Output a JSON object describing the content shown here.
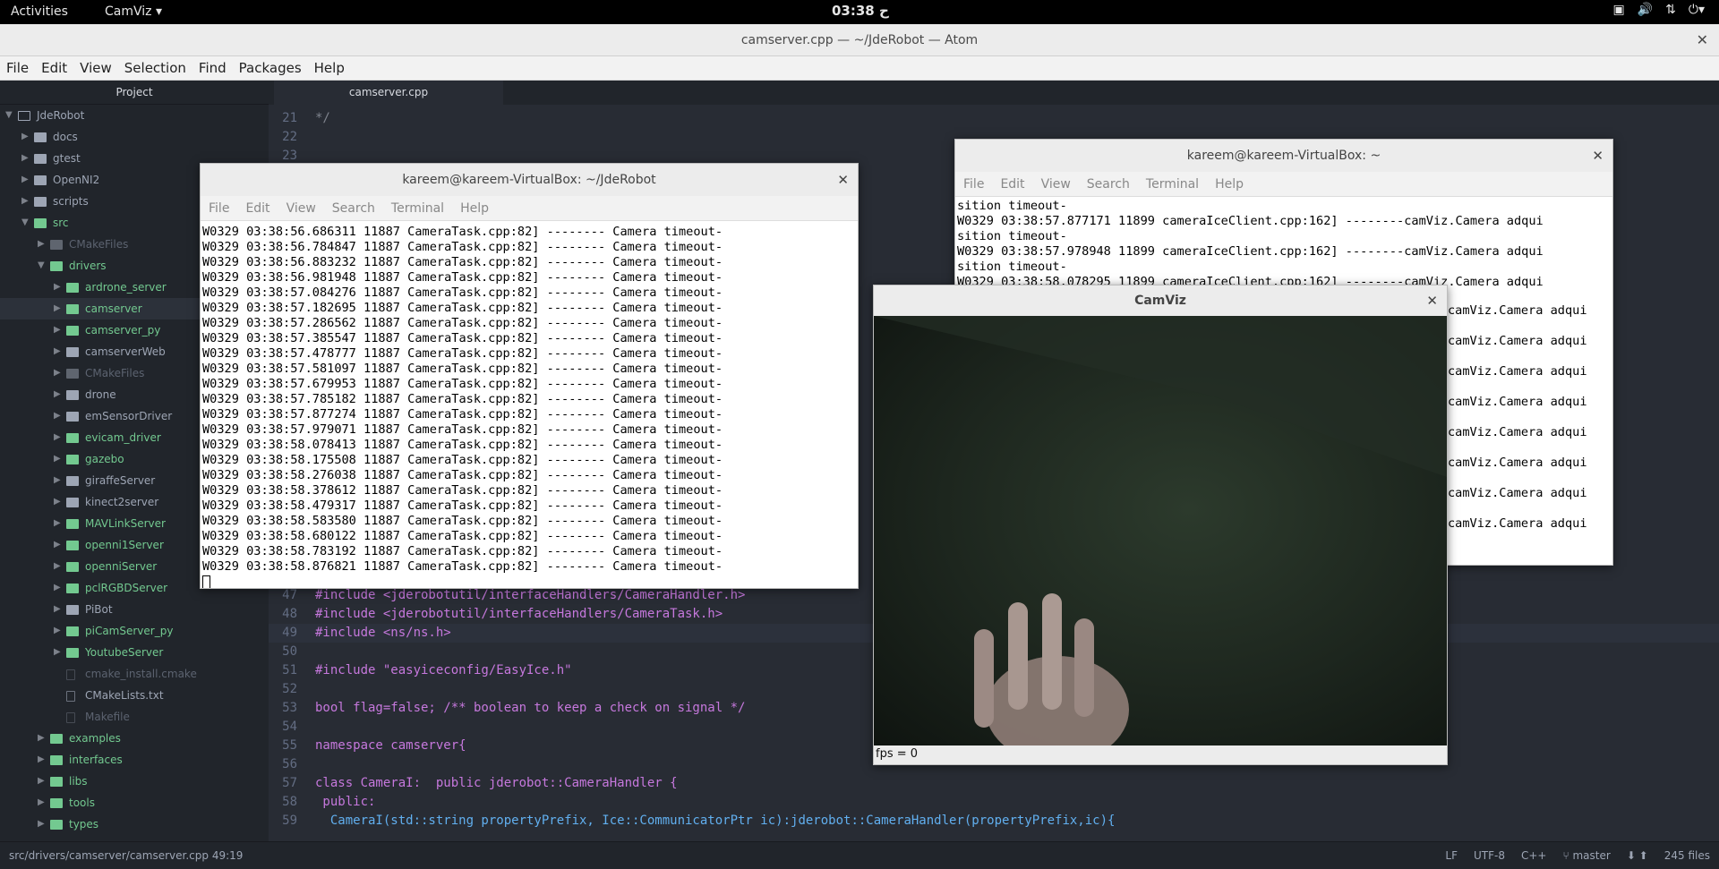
{
  "topbar": {
    "activities": "Activities",
    "app_menu": "CamViz ▾",
    "clock": "03:38 ح"
  },
  "atom": {
    "title": "camserver.cpp — ~/JdeRobot — Atom",
    "menu": [
      "File",
      "Edit",
      "View",
      "Selection",
      "Find",
      "Packages",
      "Help"
    ],
    "project_header": "Project",
    "tab": "camserver.cpp",
    "tree": [
      {
        "label": "JdeRobot",
        "depth": 0,
        "type": "repo",
        "open": true
      },
      {
        "label": "docs",
        "depth": 1,
        "type": "dir"
      },
      {
        "label": "gtest",
        "depth": 1,
        "type": "dir"
      },
      {
        "label": "OpenNI2",
        "depth": 1,
        "type": "dir"
      },
      {
        "label": "scripts",
        "depth": 1,
        "type": "dir"
      },
      {
        "label": "src",
        "depth": 1,
        "type": "dir-open-green"
      },
      {
        "label": "CMakeFiles",
        "depth": 2,
        "type": "dir-dim"
      },
      {
        "label": "drivers",
        "depth": 2,
        "type": "dir-open-green"
      },
      {
        "label": "ardrone_server",
        "depth": 3,
        "type": "dir-green"
      },
      {
        "label": "camserver",
        "depth": 3,
        "type": "dir-green",
        "selected": true
      },
      {
        "label": "camserver_py",
        "depth": 3,
        "type": "dir-green"
      },
      {
        "label": "camserverWeb",
        "depth": 3,
        "type": "dir"
      },
      {
        "label": "CMakeFiles",
        "depth": 3,
        "type": "dir-dim"
      },
      {
        "label": "drone",
        "depth": 3,
        "type": "dir"
      },
      {
        "label": "emSensorDriver",
        "depth": 3,
        "type": "dir"
      },
      {
        "label": "evicam_driver",
        "depth": 3,
        "type": "dir-green"
      },
      {
        "label": "gazebo",
        "depth": 3,
        "type": "dir-green"
      },
      {
        "label": "giraffeServer",
        "depth": 3,
        "type": "dir"
      },
      {
        "label": "kinect2server",
        "depth": 3,
        "type": "dir"
      },
      {
        "label": "MAVLinkServer",
        "depth": 3,
        "type": "dir-green"
      },
      {
        "label": "openni1Server",
        "depth": 3,
        "type": "dir-green"
      },
      {
        "label": "openniServer",
        "depth": 3,
        "type": "dir-green"
      },
      {
        "label": "pclRGBDServer",
        "depth": 3,
        "type": "dir-green"
      },
      {
        "label": "PiBot",
        "depth": 3,
        "type": "dir"
      },
      {
        "label": "piCamServer_py",
        "depth": 3,
        "type": "dir-green"
      },
      {
        "label": "YoutubeServer",
        "depth": 3,
        "type": "dir-green"
      },
      {
        "label": "cmake_install.cmake",
        "depth": 3,
        "type": "file-dim"
      },
      {
        "label": "CMakeLists.txt",
        "depth": 3,
        "type": "file"
      },
      {
        "label": "Makefile",
        "depth": 3,
        "type": "file-dim"
      },
      {
        "label": "examples",
        "depth": 2,
        "type": "dir-green"
      },
      {
        "label": "interfaces",
        "depth": 2,
        "type": "dir-green"
      },
      {
        "label": "libs",
        "depth": 2,
        "type": "dir-green"
      },
      {
        "label": "tools",
        "depth": 2,
        "type": "dir-green"
      },
      {
        "label": "types",
        "depth": 2,
        "type": "dir-green"
      }
    ],
    "code_top": [
      {
        "n": "21",
        "t": "*/"
      },
      {
        "n": "22",
        "t": ""
      },
      {
        "n": "23",
        "t": ""
      }
    ],
    "code_bottom": [
      {
        "n": "47",
        "t": "#include <jderobotutil/interfaceHandlers/CameraHandler.h>"
      },
      {
        "n": "48",
        "t": "#include <jderobotutil/interfaceHandlers/CameraTask.h>"
      },
      {
        "n": "49",
        "t": "#include <ns/ns.h>"
      },
      {
        "n": "50",
        "t": ""
      },
      {
        "n": "51",
        "t": "#include \"easyiceconfig/EasyIce.h\""
      },
      {
        "n": "52",
        "t": ""
      },
      {
        "n": "53",
        "t": "bool flag=false; /** boolean to keep a check on signal */"
      },
      {
        "n": "54",
        "t": ""
      },
      {
        "n": "55",
        "t": "namespace camserver{"
      },
      {
        "n": "56",
        "t": ""
      },
      {
        "n": "57",
        "t": "class CameraI:  public jderobot::CameraHandler {"
      },
      {
        "n": "58",
        "t": " public:"
      },
      {
        "n": "59",
        "t": "  CameraI(std::string propertyPrefix, Ice::CommunicatorPtr ic):jderobot::CameraHandler(propertyPrefix,ic){"
      }
    ],
    "status_left": "src/drivers/camserver/camserver.cpp     49:19",
    "status_right": [
      "LF",
      "UTF-8",
      "C++",
      "⑂ master",
      "⬇ ⬆",
      "245 files"
    ]
  },
  "term1": {
    "title": "kareem@kareem-VirtualBox: ~/JdeRobot",
    "menu": [
      "File",
      "Edit",
      "View",
      "Search",
      "Terminal",
      "Help"
    ],
    "lines": [
      "W0329 03:38:56.686311 11887 CameraTask.cpp:82] -------- Camera timeout-",
      "W0329 03:38:56.784847 11887 CameraTask.cpp:82] -------- Camera timeout-",
      "W0329 03:38:56.883232 11887 CameraTask.cpp:82] -------- Camera timeout-",
      "W0329 03:38:56.981948 11887 CameraTask.cpp:82] -------- Camera timeout-",
      "W0329 03:38:57.084276 11887 CameraTask.cpp:82] -------- Camera timeout-",
      "W0329 03:38:57.182695 11887 CameraTask.cpp:82] -------- Camera timeout-",
      "W0329 03:38:57.286562 11887 CameraTask.cpp:82] -------- Camera timeout-",
      "W0329 03:38:57.385547 11887 CameraTask.cpp:82] -------- Camera timeout-",
      "W0329 03:38:57.478777 11887 CameraTask.cpp:82] -------- Camera timeout-",
      "W0329 03:38:57.581097 11887 CameraTask.cpp:82] -------- Camera timeout-",
      "W0329 03:38:57.679953 11887 CameraTask.cpp:82] -------- Camera timeout-",
      "W0329 03:38:57.785182 11887 CameraTask.cpp:82] -------- Camera timeout-",
      "W0329 03:38:57.877274 11887 CameraTask.cpp:82] -------- Camera timeout-",
      "W0329 03:38:57.979071 11887 CameraTask.cpp:82] -------- Camera timeout-",
      "W0329 03:38:58.078413 11887 CameraTask.cpp:82] -------- Camera timeout-",
      "W0329 03:38:58.175508 11887 CameraTask.cpp:82] -------- Camera timeout-",
      "W0329 03:38:58.276038 11887 CameraTask.cpp:82] -------- Camera timeout-",
      "W0329 03:38:58.378612 11887 CameraTask.cpp:82] -------- Camera timeout-",
      "W0329 03:38:58.479317 11887 CameraTask.cpp:82] -------- Camera timeout-",
      "W0329 03:38:58.583580 11887 CameraTask.cpp:82] -------- Camera timeout-",
      "W0329 03:38:58.680122 11887 CameraTask.cpp:82] -------- Camera timeout-",
      "W0329 03:38:58.783192 11887 CameraTask.cpp:82] -------- Camera timeout-",
      "W0329 03:38:58.876821 11887 CameraTask.cpp:82] -------- Camera timeout-"
    ]
  },
  "term2": {
    "title": "kareem@kareem-VirtualBox: ~",
    "menu": [
      "File",
      "Edit",
      "View",
      "Search",
      "Terminal",
      "Help"
    ],
    "lines": [
      "sition timeout-",
      "W0329 03:38:57.877171 11899 cameraIceClient.cpp:162] --------camViz.Camera adqui",
      "sition timeout-",
      "W0329 03:38:57.978948 11899 cameraIceClient.cpp:162] --------camViz.Camera adqui",
      "sition timeout-",
      "W0329 03:38:58.078295 11899 cameraIceClient.cpp:162] --------camViz.Camera adqui"
    ],
    "right_lines": [
      "camViz.Camera adqui",
      "camViz.Camera adqui",
      "camViz.Camera adqui",
      "camViz.Camera adqui",
      "camViz.Camera adqui",
      "camViz.Camera adqui",
      "camViz.Camera adqui",
      "camViz.Camera adqui"
    ]
  },
  "camviz": {
    "title": "CamViz",
    "fps": "fps = 0"
  }
}
